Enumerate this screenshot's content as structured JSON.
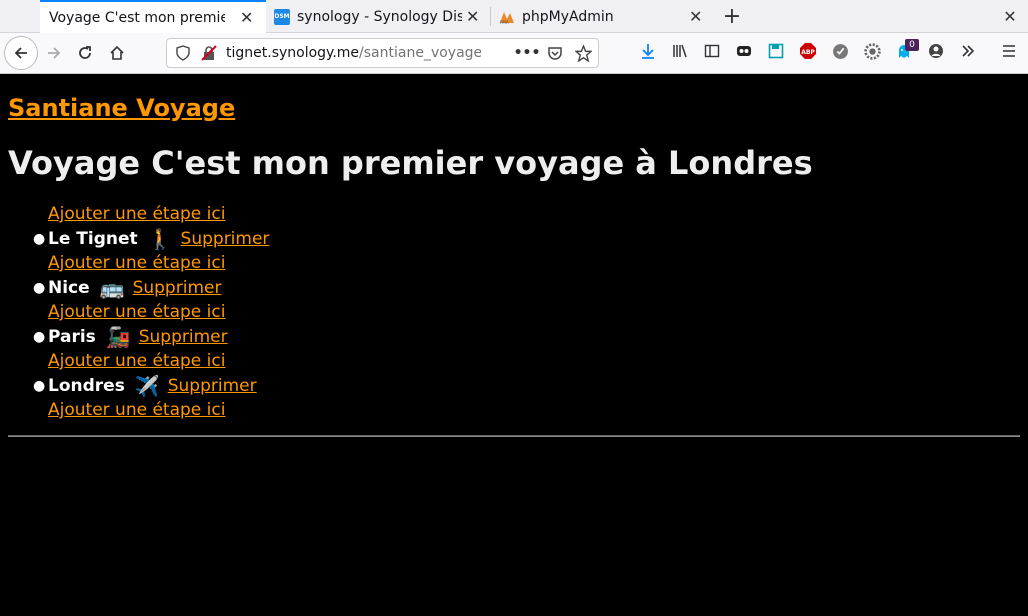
{
  "tabs": [
    {
      "title": "Voyage C'est mon premier v",
      "active": true,
      "favicon": "page-icon"
    },
    {
      "title": "synology - Synology Disk",
      "active": false,
      "favicon": "dsm-icon"
    },
    {
      "title": "phpMyAdmin",
      "active": false,
      "favicon": "pma-icon"
    }
  ],
  "urlbar": {
    "host": "tignet.synology.me",
    "path": "/santiane_voyage/vi"
  },
  "toolbar": {
    "ghost_badge": "0"
  },
  "page": {
    "site_title": "Santiane Voyage",
    "heading": "Voyage C'est mon premier voyage à Londres",
    "add_label": "Ajouter une étape ici",
    "delete_label": "Supprimer",
    "stages": [
      {
        "name": "Le Tignet",
        "emoji": "🚶"
      },
      {
        "name": "Nice",
        "emoji": "🚌"
      },
      {
        "name": "Paris",
        "emoji": "🚂"
      },
      {
        "name": "Londres",
        "emoji": "✈️"
      }
    ]
  },
  "colors": {
    "link": "#ff9800",
    "background": "#000000",
    "accent": "#0a84ff"
  }
}
